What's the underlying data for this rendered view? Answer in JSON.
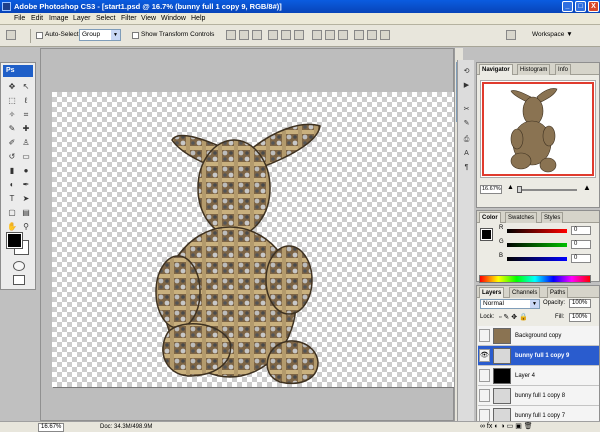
{
  "window": {
    "title": "Adobe Photoshop CS3 - [start1.psd @ 16.7% (bunny full 1 copy 9, RGB/8#)]",
    "buttons": [
      "_",
      "□",
      "X"
    ]
  },
  "menu": [
    "File",
    "Edit",
    "Image",
    "Layer",
    "Select",
    "Filter",
    "View",
    "Window",
    "Help"
  ],
  "options_bar": {
    "auto_select_label": "Auto-Select:",
    "auto_select_value": "Group",
    "show_transform_label": "Show Transform Controls",
    "workspace_label": "Workspace ▼"
  },
  "toolbox": {
    "badge": "Ps",
    "tools": [
      "move-tool",
      "marquee-tool",
      "lasso-tool",
      "magic-wand-tool",
      "crop-tool",
      "slice-tool",
      "healing-brush-tool",
      "brush-tool",
      "clone-stamp-tool",
      "history-brush-tool",
      "eraser-tool",
      "gradient-tool",
      "blur-tool",
      "dodge-tool",
      "pen-tool",
      "type-tool",
      "path-selection-tool",
      "shape-tool",
      "notes-tool",
      "eyedropper-tool",
      "hand-tool",
      "zoom-tool"
    ],
    "foreground_color": "#000000",
    "background_color": "#ffffff"
  },
  "status": {
    "zoom": "16.67%",
    "doc_info": "Doc: 34.3M/498.9M"
  },
  "navigator": {
    "tabs": [
      "Navigator",
      "Histogram",
      "Info"
    ],
    "zoom": "16.67%"
  },
  "color_panel": {
    "tabs": [
      "Color",
      "Swatches",
      "Styles"
    ],
    "channels": [
      {
        "label": "R",
        "value": "0",
        "color": "#e02020"
      },
      {
        "label": "G",
        "value": "0",
        "color": "#20b020"
      },
      {
        "label": "B",
        "value": "0",
        "color": "#2030e0"
      }
    ]
  },
  "layers_panel": {
    "tabs": [
      "Layers",
      "Channels",
      "Paths"
    ],
    "blend_mode": "Normal",
    "opacity_label": "Opacity:",
    "opacity_value": "100%",
    "lock_label": "Lock:",
    "fill_label": "Fill:",
    "fill_value": "100%",
    "layers": [
      {
        "name": "Background copy",
        "visible": false,
        "selected": false,
        "thumb": "bunny"
      },
      {
        "name": "bunny full 1 copy 9",
        "visible": true,
        "selected": true,
        "thumb": "bunny"
      },
      {
        "name": "Layer 4",
        "visible": false,
        "selected": false,
        "thumb": "black"
      },
      {
        "name": "bunny full 1 copy 8",
        "visible": false,
        "selected": false,
        "thumb": "bunny"
      },
      {
        "name": "bunny full 1 copy 7",
        "visible": false,
        "selected": false,
        "thumb": "bunny"
      }
    ]
  },
  "accent_colors": {
    "selected_layer": "#2a5cce",
    "titlebar": "#0a5ce0",
    "navigator_box": "#e03b2e"
  }
}
